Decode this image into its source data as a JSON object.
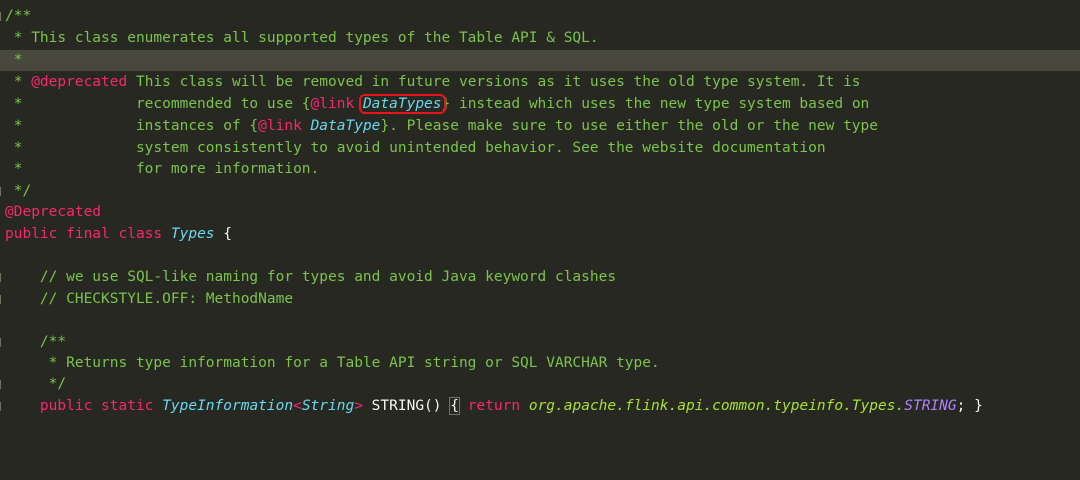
{
  "editor": {
    "lines": {
      "l1": "/**",
      "l2": " * This class enumerates all supported types of the Table API & SQL.",
      "l3": " *",
      "l4_star": " * ",
      "l4_tag": "@deprecated",
      "l4_text": " This class will be removed in future versions as it uses the old type system. It is",
      "l5_pre": " *             recommended to use {",
      "l5_link": "@link",
      "l5_sp": " ",
      "l5_ref": "DataTypes",
      "l5_post": "} instead which uses the new type system based on",
      "l6_pre": " *             instances of {",
      "l6_link": "@link",
      "l6_sp": " ",
      "l6_ref": "DataType",
      "l6_post": "}. Please make sure to use either the old or the new type",
      "l7": " *             system consistently to avoid unintended behavior. See the website documentation",
      "l8": " *             for more information.",
      "l9": " */",
      "l10": "@Deprecated",
      "l11_kw": "public final class ",
      "l11_type": "Types",
      "l11_brace": " {",
      "l13": "    // we use SQL-like naming for types and avoid Java keyword clashes",
      "l14": "    // CHECKSTYLE.OFF: MethodName",
      "l16": "    /**",
      "l17": "     * Returns type information for a Table API string or SQL VARCHAR type.",
      "l18": "     */",
      "l19_indent": "    ",
      "l19_kw": "public static ",
      "l19_type": "TypeInformation",
      "l19_lt": "<",
      "l19_generic": "String",
      "l19_gt": ">",
      "l19_method": " STRING() ",
      "l19_open": "{",
      "l19_ret": " return ",
      "l19_qual": "org.apache.flink.api.common.typeinfo.Types.",
      "l19_const": "STRING",
      "l19_semi": ";",
      "l19_close": " }"
    }
  }
}
